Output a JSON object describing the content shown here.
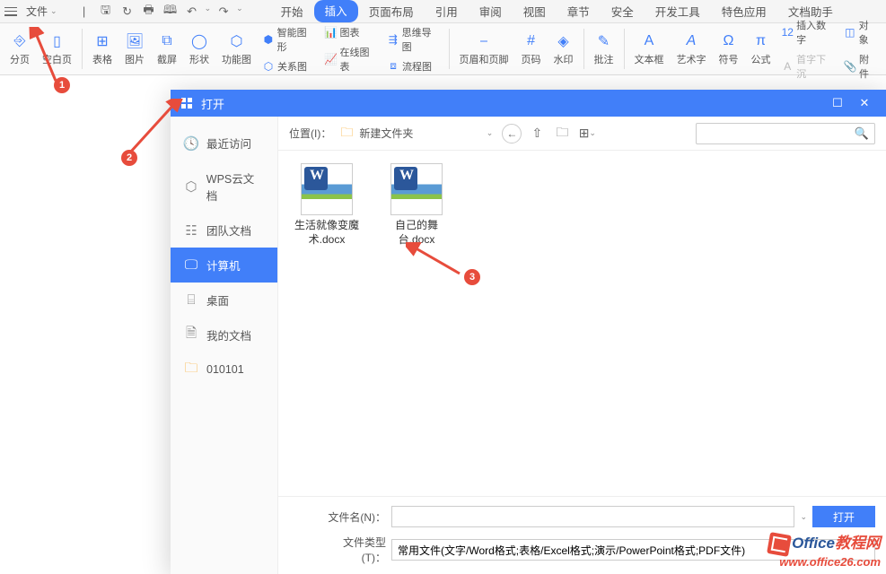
{
  "topbar": {
    "file_menu": "文件",
    "tabs": [
      "开始",
      "插入",
      "页面布局",
      "引用",
      "审阅",
      "视图",
      "章节",
      "安全",
      "开发工具",
      "特色应用",
      "文档助手"
    ],
    "active_tab_index": 1
  },
  "ribbon": {
    "groups": [
      {
        "label": "分页",
        "icon": "page-break"
      },
      {
        "label": "空白页",
        "icon": "blank-page"
      },
      {
        "label": "表格",
        "icon": "table"
      },
      {
        "label": "图片",
        "icon": "picture"
      },
      {
        "label": "截屏",
        "icon": "screenshot"
      },
      {
        "label": "形状",
        "icon": "shapes"
      },
      {
        "label": "功能图",
        "icon": "smartart"
      }
    ],
    "inline_items": [
      [
        "智能图形",
        "图表"
      ],
      [
        "关系图",
        "在线图表",
        "流程图"
      ]
    ],
    "inline_items_b": [
      "思维导图"
    ],
    "groups2": [
      {
        "label": "页眉和页脚",
        "icon": "header-footer"
      },
      {
        "label": "页码",
        "icon": "page-number"
      },
      {
        "label": "水印",
        "icon": "watermark"
      },
      {
        "label": "批注",
        "icon": "comment"
      },
      {
        "label": "文本框",
        "icon": "textbox"
      },
      {
        "label": "艺术字",
        "icon": "wordart"
      },
      {
        "label": "符号",
        "icon": "symbol"
      },
      {
        "label": "公式",
        "icon": "equation"
      }
    ],
    "inline_items2": [
      [
        "插入数字",
        "对象"
      ],
      [
        "首字下沉",
        "附件"
      ]
    ]
  },
  "dialog": {
    "title": "打开",
    "sidebar": [
      {
        "label": "最近访问",
        "icon": "clock"
      },
      {
        "label": "WPS云文档",
        "icon": "cloud"
      },
      {
        "label": "团队文档",
        "icon": "team"
      },
      {
        "label": "计算机",
        "icon": "computer",
        "active": true
      },
      {
        "label": "桌面",
        "icon": "desktop"
      },
      {
        "label": "我的文档",
        "icon": "mydocs"
      },
      {
        "label": "010101",
        "icon": "folder"
      }
    ],
    "location_label": "位置(I)：",
    "location_value": "新建文件夹",
    "files": [
      {
        "name": "生活就像变魔术.docx"
      },
      {
        "name": "自己的舞台.docx"
      }
    ],
    "filename_label": "文件名(N)：",
    "filename_value": "",
    "filetype_label": "文件类型(T)：",
    "filetype_value": "常用文件(文字/Word格式;表格/Excel格式;演示/PowerPoint格式;PDF文件)",
    "open_button": "打开"
  },
  "badges": [
    "1",
    "2",
    "3"
  ],
  "watermark": {
    "line1_a": "Office",
    "line1_b": "教程网",
    "line2": "www.office26.com"
  }
}
